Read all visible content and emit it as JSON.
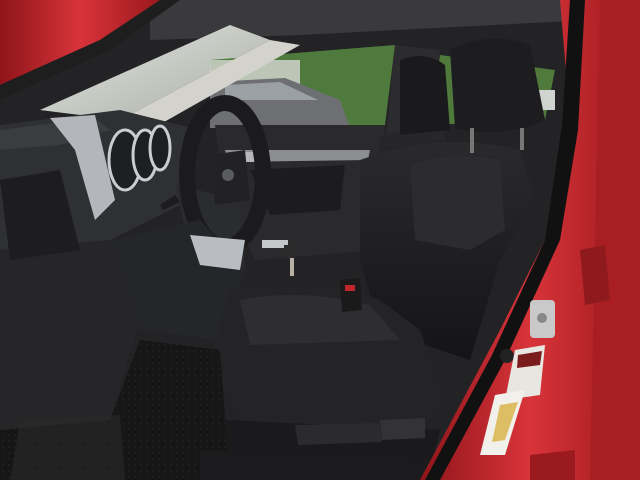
{
  "scene": {
    "subject": "car-interior-driver-side",
    "colors": {
      "body_paint": "#c0262b",
      "paint_shadow": "#7e1418",
      "seat_fabric": "#1f1f21",
      "dashboard": "#2a2b2e",
      "silver_trim": "#b9bcc0",
      "floor_mat": "#151515",
      "window_green": "#3f6b35",
      "sky": "#d9dcd6"
    },
    "labels": {
      "door_sticker_text": "",
      "tire_placard_text": ""
    }
  }
}
